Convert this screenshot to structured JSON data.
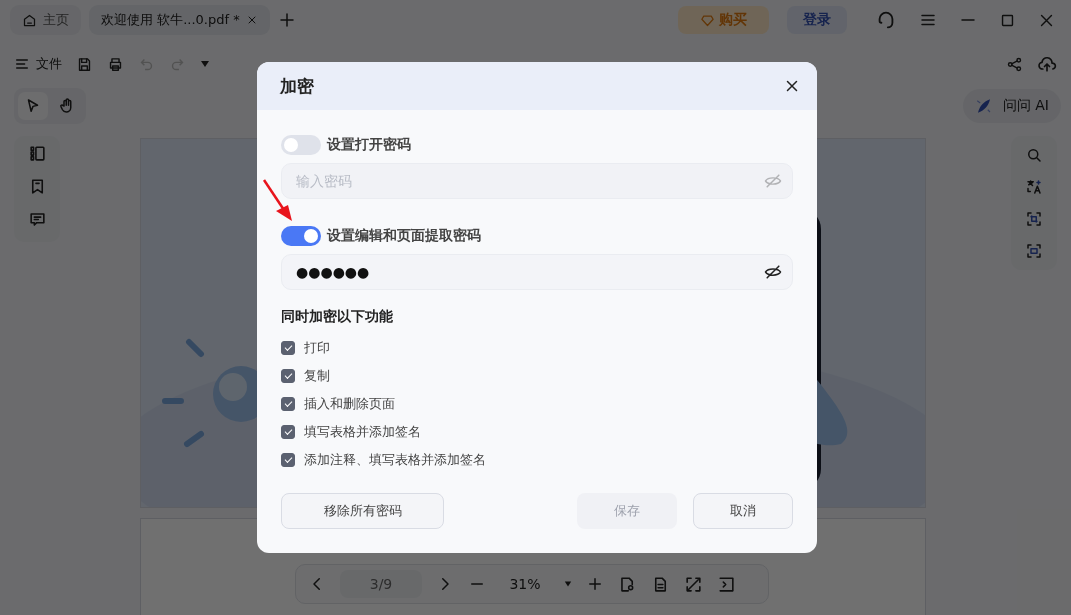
{
  "tabs": [
    {
      "kind": "home",
      "label": "主页",
      "selected": false
    },
    {
      "kind": "document",
      "label": "欢迎使用 软牛...0.pdf *",
      "selected": true
    }
  ],
  "title_bar": {
    "buy_button": "购买",
    "login_button": "登录"
  },
  "toolbar": {
    "file_menu": "文件",
    "ai_button": "问问 AI"
  },
  "page_nav": {
    "page": "3/9",
    "zoom": "31%"
  },
  "dialog": {
    "title": "加密",
    "options": [
      {
        "label": "设置打开密码",
        "on": false,
        "field": {
          "placeholder": "输入密码",
          "disabled": true
        }
      },
      {
        "label": "设置编辑和页面提取密码",
        "on": true,
        "field": {
          "value": "●●●●●●",
          "disabled": false
        }
      }
    ],
    "section_title": "同时加密以下功能",
    "permissions": [
      {
        "label": "打印",
        "checked": true
      },
      {
        "label": "复制",
        "checked": true
      },
      {
        "label": "插入和删除页面",
        "checked": true
      },
      {
        "label": "填写表格并添加签名",
        "checked": true
      },
      {
        "label": "添加注释、填写表格并添加签名",
        "checked": true
      }
    ],
    "remove_button": "移除所有密码",
    "save_button": {
      "label": "保存",
      "disabled": true
    },
    "cancel_button": "取消"
  }
}
